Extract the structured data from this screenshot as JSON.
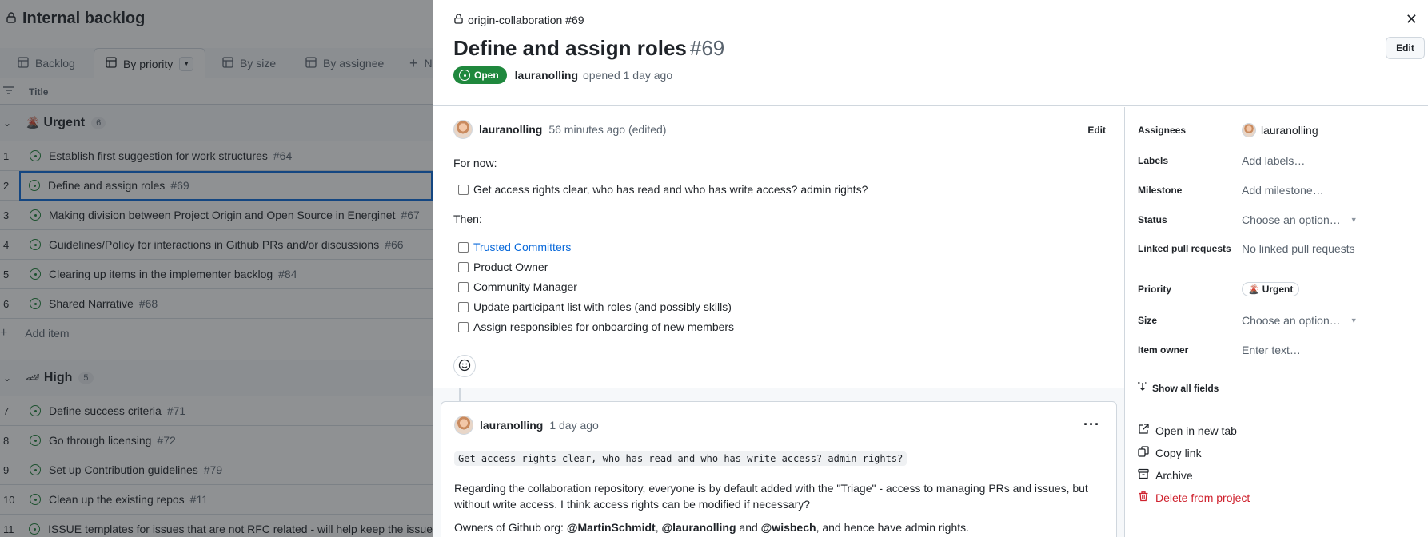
{
  "board": {
    "title": "Internal backlog",
    "views": [
      {
        "label": "Backlog"
      },
      {
        "label": "By priority"
      },
      {
        "label": "By size"
      },
      {
        "label": "By assignee"
      },
      {
        "label": "N"
      }
    ],
    "column_title": "Title",
    "groups": [
      {
        "name": "Urgent",
        "count": "6"
      },
      {
        "name": "High",
        "count": "5"
      }
    ],
    "rows": [
      {
        "num": "1",
        "title": "Establish first suggestion for work structures",
        "issue": "#64"
      },
      {
        "num": "2",
        "title": "Define and assign roles",
        "issue": "#69"
      },
      {
        "num": "3",
        "title": "Making division between Project Origin and Open Source in Energinet",
        "issue": "#67"
      },
      {
        "num": "4",
        "title": "Guidelines/Policy for interactions in Github PRs and/or discussions",
        "issue": "#66"
      },
      {
        "num": "5",
        "title": "Clearing up items in the implementer backlog",
        "issue": "#84"
      },
      {
        "num": "6",
        "title": "Shared Narrative",
        "issue": "#68"
      },
      {
        "num": "7",
        "title": "Define success criteria",
        "issue": "#71"
      },
      {
        "num": "8",
        "title": "Go through licensing",
        "issue": "#72"
      },
      {
        "num": "9",
        "title": "Set up Contribution guidelines",
        "issue": "#79"
      },
      {
        "num": "10",
        "title": "Clean up the existing repos",
        "issue": "#11"
      },
      {
        "num": "11",
        "title": "ISSUE templates for issues that are not RFC related - will help keep the issue",
        "issue": ""
      }
    ],
    "add_item": "Add item"
  },
  "panel": {
    "repo": "origin-collaboration #69",
    "title": "Define and assign roles",
    "number": "#69",
    "edit_label": "Edit",
    "state": "Open",
    "author": "lauranolling",
    "opened": "opened 1 day ago",
    "body": {
      "author": "lauranolling",
      "time": "56 minutes ago (edited)",
      "edit": "Edit",
      "for_now": "For now:",
      "task1": "Get access rights clear, who has read and who has write access? admin rights?",
      "then": "Then:",
      "tasks": [
        "Trusted Committers",
        "Product Owner",
        "Community Manager",
        "Update participant list with roles (and possibly skills)",
        "Assign responsibles for onboarding of new members"
      ]
    },
    "comment": {
      "author": "lauranolling",
      "time": "1 day ago",
      "quote": "Get access rights clear, who has read and who has write access? admin rights?",
      "para1": "Regarding the collaboration repository, everyone is by default added with the \"Triage\" - access to managing PRs and issues, but without write access. I think access rights can be modified if necessary?",
      "para2_start": "Owners of Github org: ",
      "m1": "@MartinSchmidt",
      "sep1": ", ",
      "m2": "@lauranolling",
      "sep2": " and ",
      "m3": "@wisbech",
      "para2_end": ", and hence have admin rights."
    },
    "fields": {
      "assignees_label": "Assignees",
      "assignee": "lauranolling",
      "labels_label": "Labels",
      "labels_val": "Add labels…",
      "milestone_label": "Milestone",
      "milestone_val": "Add milestone…",
      "status_label": "Status",
      "status_val": "Choose an option…",
      "linked_label": "Linked pull requests",
      "linked_val": "No linked pull requests",
      "priority_label": "Priority",
      "priority_val": "Urgent",
      "size_label": "Size",
      "size_val": "Choose an option…",
      "owner_label": "Item owner",
      "owner_val": "Enter text…",
      "show_all": "Show all fields"
    },
    "actions": {
      "open_tab": "Open in new tab",
      "copy_link": "Copy link",
      "archive": "Archive",
      "delete": "Delete from project"
    }
  },
  "colors": {
    "open_green": "#1f883d",
    "link_blue": "#0969da",
    "danger_red": "#cf222e"
  }
}
